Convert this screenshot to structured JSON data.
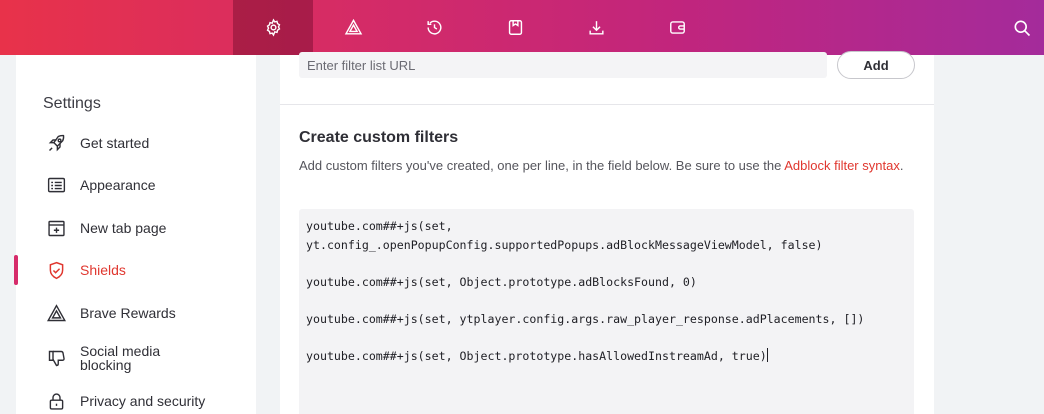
{
  "topbar": {
    "tabs": [
      {
        "id": "settings",
        "icon": "gear-icon",
        "active": true
      },
      {
        "id": "rewards",
        "icon": "brave-rewards-icon",
        "active": false
      },
      {
        "id": "history",
        "icon": "history-icon",
        "active": false
      },
      {
        "id": "bookmarks",
        "icon": "bookmark-icon",
        "active": false
      },
      {
        "id": "downloads",
        "icon": "download-icon",
        "active": false
      },
      {
        "id": "wallet",
        "icon": "wallet-icon",
        "active": false
      }
    ],
    "search_icon": "search-icon",
    "gradient": [
      "#e8324a",
      "#a42b9b"
    ]
  },
  "sidebar": {
    "title": "Settings",
    "items": [
      {
        "label": "Get started",
        "icon": "rocket-icon",
        "active": false
      },
      {
        "label": "Appearance",
        "icon": "appearance-icon",
        "active": false
      },
      {
        "label": "New tab page",
        "icon": "new-tab-icon",
        "active": false
      },
      {
        "label": "Shields",
        "icon": "shield-icon",
        "active": true
      },
      {
        "label": "Brave Rewards",
        "icon": "brave-rewards-icon",
        "active": false
      },
      {
        "label": "Social media blocking",
        "icon": "thumbs-down-icon",
        "active": false
      },
      {
        "label": "Privacy and security",
        "icon": "lock-icon",
        "active": false
      }
    ]
  },
  "main": {
    "filter_list_url": {
      "placeholder": "Enter filter list URL",
      "value": ""
    },
    "add_label": "Add",
    "custom_filters": {
      "title": "Create custom filters",
      "description_before": "Add custom filters you've created, one per line, in the field below. Be sure to use the ",
      "description_link": "Adblock filter syntax",
      "description_after": ".",
      "text": "youtube.com##+js(set, yt.config_.openPopupConfig.supportedPopups.adBlockMessageViewModel, false)\n\nyoutube.com##+js(set, Object.prototype.adBlocksFound, 0)\n\nyoutube.com##+js(set, ytplayer.config.args.raw_player_response.adPlacements, [])\n\nyoutube.com##+js(set, Object.prototype.hasAllowedInstreamAd, true)"
    }
  },
  "colors": {
    "accent": "#e0372f",
    "active_indicator": "#d62b6a"
  }
}
